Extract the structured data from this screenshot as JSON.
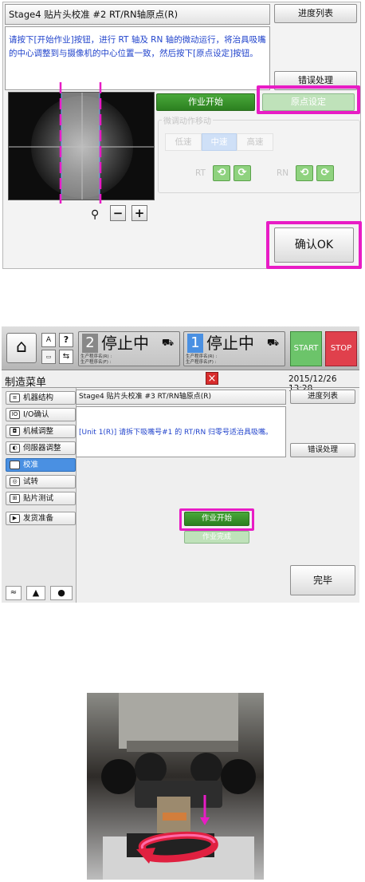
{
  "panel1": {
    "title": "Stage4 贴片头校准 #2 RT/RN轴原点(R)",
    "progress_list": "进度列表",
    "instruction_line1": "请按下[开始作业]按钮，进行 RT 轴及 RN 轴的微动运行，将治具吸嘴",
    "instruction_line2": "的中心调整到与摄像机的中心位置一致，然后按下[原点设定]按钮。",
    "error_handling": "错误处理",
    "start_work": "作业开始",
    "origin_set": "原点设定",
    "micro_move_label": "微调动作移动",
    "speed_low": "低速",
    "speed_mid": "中速",
    "speed_high": "高速",
    "rt_label": "RT",
    "rn_label": "RN",
    "zoom_minus": "−",
    "zoom_plus": "+",
    "confirm_ok": "确认OK"
  },
  "panel2": {
    "status_left_num": "2",
    "status_left_text": "停止中",
    "status_left_sub1": "生产程序名(R) :",
    "status_left_sub2": "生产程序名(F) :",
    "status_right_num": "1",
    "status_right_text": "停止中",
    "status_right_sub1": "生产程序名(R) :",
    "status_right_sub2": "生产程序名(F) :",
    "start": "START",
    "stop": "STOP",
    "menu_title": "制造菜单",
    "datetime": "2015/12/26 13:28",
    "close": "×",
    "sidebar": [
      {
        "label": "机器结构",
        "icon": "≡"
      },
      {
        "label": "I/O确认",
        "icon": "IO"
      },
      {
        "label": "机械调整",
        "icon": "◘"
      },
      {
        "label": "伺服器调整",
        "icon": "◐"
      },
      {
        "label": "校准",
        "icon": "⊡"
      },
      {
        "label": "试转",
        "icon": "◎"
      },
      {
        "label": "贴片测试",
        "icon": "⊞"
      },
      {
        "label": "发货准备",
        "icon": "▶"
      }
    ],
    "title": "Stage4 贴片头校准 #3 RT/RN轴原点(R)",
    "progress_list": "进度列表",
    "message": "[Unit 1(R)] 请拆下吸嘴号#1 的 RT/RN 归零号适治具吸嘴。",
    "error_handling": "错误处理",
    "start_work": "作业开始",
    "work_done": "作业完成",
    "finish": "完毕"
  },
  "colors": {
    "magenta": "#e81cc5",
    "green": "#3a9a2c",
    "light_green": "#bfe2ba",
    "selected_blue": "#4a90e2",
    "stop_red": "#e0404c",
    "start_green": "#6cc46a",
    "message_blue": "#2244cc"
  }
}
